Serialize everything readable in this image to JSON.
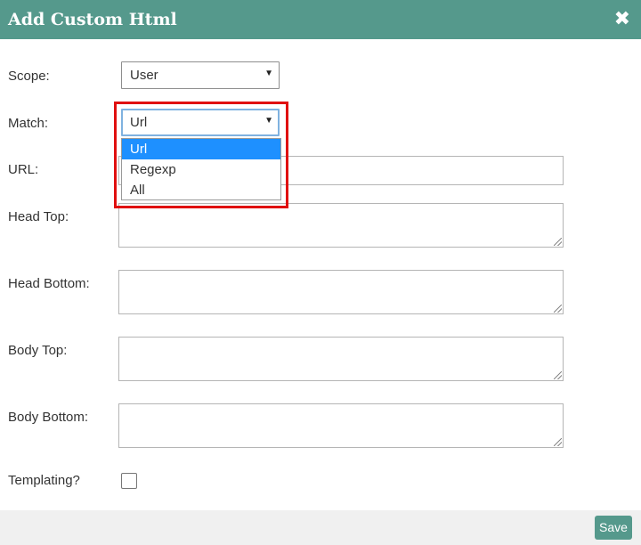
{
  "dialog": {
    "title": "Add Custom Html",
    "close_icon": "close-icon",
    "accent_color": "#55998c"
  },
  "form": {
    "scope": {
      "label": "Scope:",
      "value": "User"
    },
    "match": {
      "label": "Match:",
      "value": "Url",
      "options": [
        "Url",
        "Regexp",
        "All"
      ],
      "selected_option": "Url"
    },
    "url": {
      "label": "URL:",
      "value": ""
    },
    "head_top": {
      "label": "Head Top:",
      "value": ""
    },
    "head_bottom": {
      "label": "Head Bottom:",
      "value": ""
    },
    "body_top": {
      "label": "Body Top:",
      "value": ""
    },
    "body_bottom": {
      "label": "Body Bottom:",
      "value": ""
    },
    "templating": {
      "label": "Templating?",
      "checked": false
    }
  },
  "footer": {
    "save_label": "Save"
  },
  "annotation": {
    "highlight_color": "#e01010"
  }
}
